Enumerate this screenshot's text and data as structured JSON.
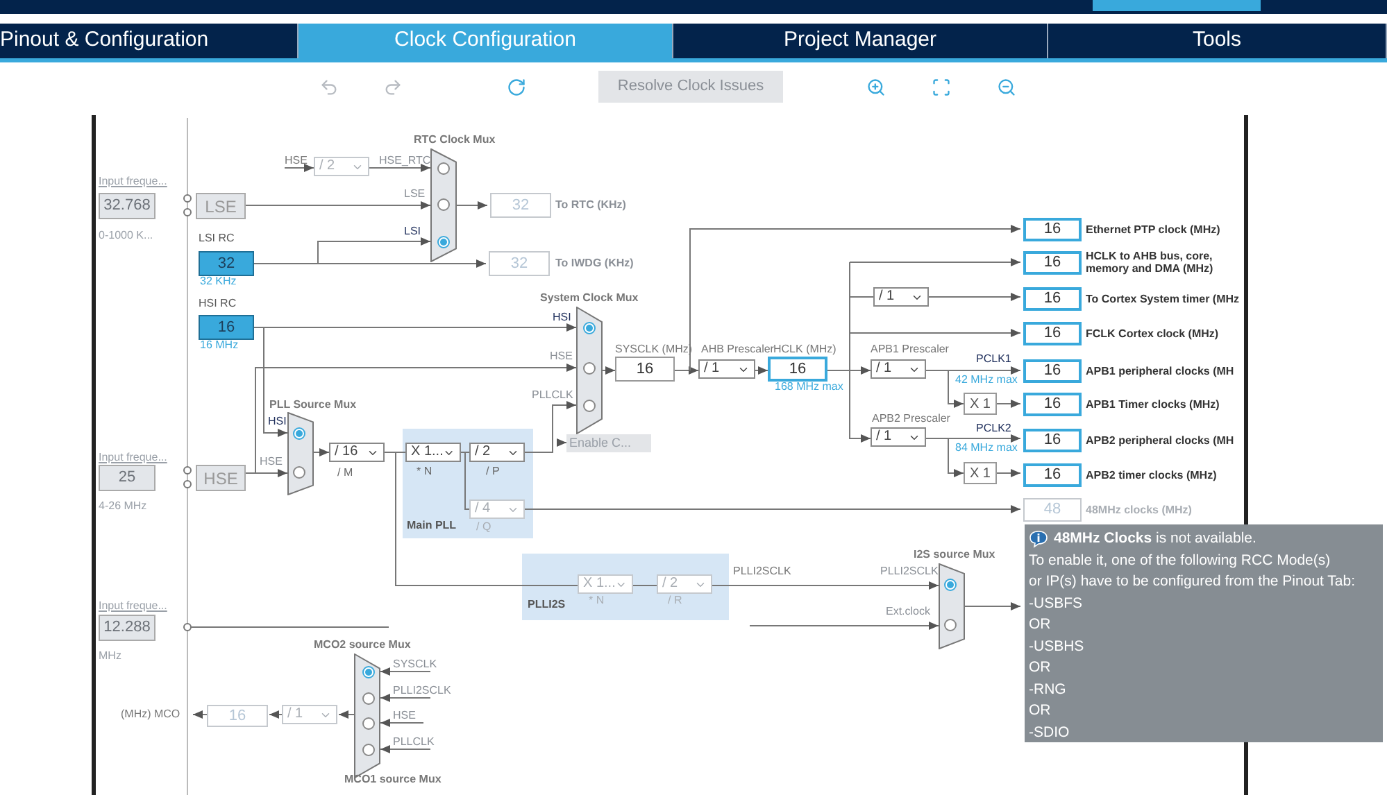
{
  "tabs": [
    {
      "label": "Pinout & Configuration",
      "selected": false
    },
    {
      "label": "Clock Configuration",
      "selected": true
    },
    {
      "label": "Project Manager",
      "selected": false
    },
    {
      "label": "Tools",
      "selected": false
    }
  ],
  "toolbar": {
    "resolve_button": "Resolve Clock Issues"
  },
  "diagram": {
    "inputs": [
      {
        "caption": "Input freque...",
        "value": "32.768",
        "range": "0-1000 K...",
        "source": "LSE"
      },
      {
        "caption": "Input freque...",
        "value": "25",
        "range": "4-26 MHz",
        "source": "HSE"
      },
      {
        "caption": "Input freque...",
        "value": "12.288",
        "range": "MHz"
      }
    ],
    "oscillators": [
      {
        "title": "LSI RC",
        "value": "32",
        "note": "32 KHz"
      },
      {
        "title": "HSI RC",
        "value": "16",
        "note": "16 MHz"
      }
    ],
    "muxes": [
      {
        "title": "RTC Clock Mux",
        "inputs": [
          {
            "label": "HSE_RTC",
            "selected": false
          },
          {
            "label": "LSE",
            "selected": false
          },
          {
            "label": "LSI",
            "selected": true
          }
        ]
      },
      {
        "title": "System Clock Mux",
        "inputs": [
          {
            "label": "HSI",
            "selected": true
          },
          {
            "label": "HSE",
            "selected": false
          },
          {
            "label": "PLLCLK",
            "selected": false
          }
        ]
      },
      {
        "title": "PLL Source Mux",
        "inputs": [
          {
            "label": "HSI",
            "selected": true
          },
          {
            "label": "HSE",
            "selected": false
          }
        ]
      },
      {
        "title": "I2S source Mux",
        "inputs": [
          {
            "label": "PLLI2SCLK",
            "selected": true
          },
          {
            "label": "Ext.clock",
            "selected": false
          }
        ]
      },
      {
        "title": "MCO2 source Mux",
        "footer": "MCO1 source Mux",
        "inputs": [
          {
            "label": "SYSCLK",
            "selected": true
          },
          {
            "label": "PLLI2SCLK",
            "selected": false
          },
          {
            "label": "HSE",
            "selected": false
          },
          {
            "label": "PLLCLK",
            "selected": false
          }
        ]
      }
    ],
    "dropdowns": [
      {
        "value": "/ 2",
        "disabled": true
      },
      {
        "value": "/ 16",
        "caption": "/ M",
        "disabled": false
      },
      {
        "value": "X 1...",
        "caption": "* N",
        "disabled": false
      },
      {
        "value": "/ 2",
        "caption": "/ P",
        "disabled": false
      },
      {
        "value": "/ 4",
        "caption": "/ Q",
        "disabled": true
      },
      {
        "value": "X 1...",
        "caption": "* N",
        "disabled": true
      },
      {
        "value": "/ 2",
        "caption": "/ R",
        "disabled": true
      },
      {
        "value": "/ 1",
        "disabled": false
      },
      {
        "value": "/ 1",
        "disabled": false
      },
      {
        "value": "/ 1",
        "disabled": false
      },
      {
        "value": "/ 1",
        "disabled": false
      },
      {
        "value": "/ 1",
        "disabled": true
      }
    ],
    "value_boxes": [
      {
        "value": "32",
        "label": "To RTC (KHz)",
        "disabled": true,
        "highlighted": false
      },
      {
        "value": "32",
        "label": "To IWDG (KHz)",
        "disabled": true,
        "highlighted": false
      },
      {
        "value": "16",
        "disabled": false,
        "highlighted": false
      },
      {
        "value": "16",
        "disabled": false,
        "highlighted": true
      },
      {
        "value": "16",
        "disabled": true,
        "highlighted": false
      }
    ],
    "outputs": [
      {
        "value": "16",
        "label": "Ethernet PTP clock (MHz)",
        "disabled": false
      },
      {
        "value": "16",
        "label": "HCLK to AHB bus, core, memory and DMA (MHz)",
        "disabled": false
      },
      {
        "value": "16",
        "label": "To Cortex System timer (MHz",
        "disabled": false
      },
      {
        "value": "16",
        "label": "FCLK Cortex clock (MHz)",
        "disabled": false
      },
      {
        "value": "16",
        "label": "APB1 peripheral clocks (MH",
        "disabled": false
      },
      {
        "value": "16",
        "label": "APB1 Timer clocks (MHz)",
        "disabled": false
      },
      {
        "value": "16",
        "label": "APB2 peripheral clocks (MH",
        "disabled": false
      },
      {
        "value": "16",
        "label": "APB2 timer clocks (MHz)",
        "disabled": false
      },
      {
        "value": "48",
        "label": "48MHz clocks (MHz)",
        "disabled": true
      }
    ],
    "multipliers": [
      "X 1",
      "X 1"
    ],
    "labels": [
      {
        "text": "HSE",
        "kind": "plain"
      },
      {
        "text": "SYSCLK (MHz)",
        "kind": "plain"
      },
      {
        "text": "AHB Prescaler",
        "kind": "plain"
      },
      {
        "text": "HCLK (MHz)",
        "kind": "plain"
      },
      {
        "text": "168 MHz max",
        "kind": "note"
      },
      {
        "text": "APB1 Prescaler",
        "kind": "plain"
      },
      {
        "text": "PCLK1",
        "kind": "signal"
      },
      {
        "text": "42 MHz max",
        "kind": "note"
      },
      {
        "text": "APB2 Prescaler",
        "kind": "plain"
      },
      {
        "text": "PCLK2",
        "kind": "signal"
      },
      {
        "text": "84 MHz max",
        "kind": "note"
      },
      {
        "text": "Main PLL",
        "kind": "title"
      },
      {
        "text": "PLLI2S",
        "kind": "title"
      },
      {
        "text": "PLLI2SCLK",
        "kind": "plain"
      },
      {
        "text": "(MHz) MCO",
        "kind": "plain"
      }
    ],
    "enable_button": {
      "label": "Enable C...",
      "disabled": true
    }
  },
  "tooltip": {
    "lines": [
      "**48MHz Clocks** is not available.",
      "To enable it, one of the following RCC Mode(s)",
      "or IP(s) have to be configured from the Pinout Tab:",
      "-USBFS",
      "OR",
      "-USBHS",
      "OR",
      "-RNG",
      "OR",
      "-SDIO"
    ]
  }
}
